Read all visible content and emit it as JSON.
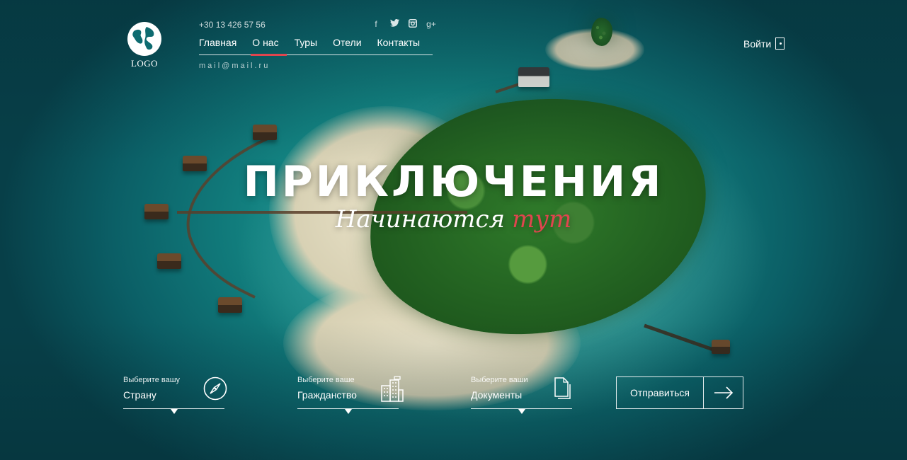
{
  "header": {
    "logo_text": "LOGO",
    "phone": "+30 13 426 57 56",
    "email": "mail@mail.ru",
    "socials": [
      "facebook-icon",
      "twitter-icon",
      "instagram-icon",
      "google-plus-icon"
    ],
    "nav": [
      {
        "label": "Главная",
        "active": false
      },
      {
        "label": "О нас",
        "active": true
      },
      {
        "label": "Туры",
        "active": false
      },
      {
        "label": "Отели",
        "active": false
      },
      {
        "label": "Контакты",
        "active": false
      }
    ],
    "login_label": "Войти"
  },
  "hero": {
    "title": "ПРИКЛЮЧЕНИЯ",
    "subtitle_white": "Начинаются",
    "subtitle_red": "тут"
  },
  "form": {
    "country": {
      "label": "Выберите вашу",
      "value": "Страну"
    },
    "citizenship": {
      "label": "Выберите ваше",
      "value": "Гражданство"
    },
    "documents": {
      "label": "Выберите ваши",
      "value": "Документы"
    },
    "submit_label": "Отправиться"
  },
  "colors": {
    "accent": "#e0454e",
    "text": "#ffffff"
  }
}
